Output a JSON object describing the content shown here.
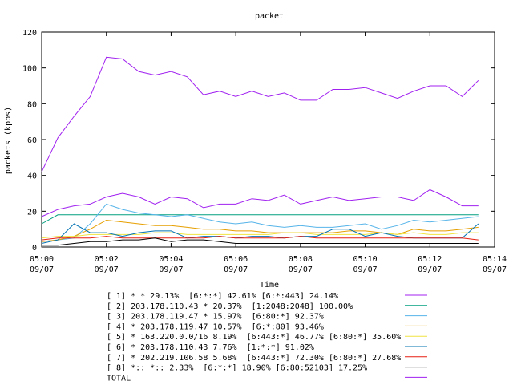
{
  "chart_data": {
    "type": "line",
    "title": "packet",
    "ylabel": "packets (kpps)",
    "xlabel": "Time",
    "ylim": [
      0,
      120
    ],
    "yticks": [
      0,
      20,
      40,
      60,
      80,
      100,
      120
    ],
    "xlim": [
      0,
      14
    ],
    "xticks": [
      {
        "t": 0,
        "time": "05:00",
        "date": "09/07"
      },
      {
        "t": 2,
        "time": "05:02",
        "date": "09/07"
      },
      {
        "t": 4,
        "time": "05:04",
        "date": "09/07"
      },
      {
        "t": 6,
        "time": "05:06",
        "date": "09/07"
      },
      {
        "t": 8,
        "time": "05:08",
        "date": "09/07"
      },
      {
        "t": 10,
        "time": "05:10",
        "date": "09/07"
      },
      {
        "t": 12,
        "time": "05:12",
        "date": "09/07"
      },
      {
        "t": 14,
        "time": "05:14",
        "date": "09/07"
      }
    ],
    "grid": false,
    "legend_position": "bottom",
    "x": [
      0,
      0.5,
      1,
      1.5,
      2,
      2.5,
      3,
      3.5,
      4,
      4.5,
      5,
      5.5,
      6,
      6.5,
      7,
      7.5,
      8,
      8.5,
      9,
      9.5,
      10,
      10.5,
      11,
      11.5,
      12,
      12.5,
      13,
      13.5
    ],
    "series": [
      {
        "name": "[ 1] * * 29.13%  [6:*:*] 42.61% [6:*:443] 24.14%",
        "color": "#a020f0",
        "values": [
          17,
          21,
          23,
          24,
          28,
          30,
          28,
          24,
          28,
          27,
          22,
          24,
          24,
          27,
          26,
          29,
          24,
          26,
          28,
          26,
          27,
          28,
          28,
          26,
          32,
          28,
          23,
          23
        ]
      },
      {
        "name": "[ 2] 203.178.110.43 * 20.37%  [1:2048:2048] 100.00%",
        "color": "#009f7f",
        "values": [
          13,
          18,
          18,
          18,
          18,
          18,
          18,
          18,
          18,
          18,
          18,
          18,
          18,
          18,
          18,
          18,
          18,
          18,
          18,
          18,
          18,
          18,
          18,
          18,
          18,
          18,
          18,
          18
        ]
      },
      {
        "name": "[ 3] 203.178.119.47 * 15.97%  [6:80:*] 92.37%",
        "color": "#56b4e9",
        "values": [
          3,
          4,
          5,
          13,
          24,
          21,
          19,
          18,
          17,
          18,
          16,
          14,
          13,
          14,
          12,
          11,
          12,
          11,
          11,
          12,
          13,
          10,
          12,
          15,
          14,
          15,
          16,
          17
        ]
      },
      {
        "name": "[ 4] * 203.178.119.47 10.57%  [6:*:80] 93.46%",
        "color": "#e69f00",
        "values": [
          3,
          4,
          6,
          10,
          15,
          14,
          13,
          12,
          12,
          11,
          10,
          10,
          9,
          9,
          8,
          8,
          8,
          8,
          8,
          9,
          9,
          8,
          7,
          10,
          9,
          9,
          10,
          11
        ]
      },
      {
        "name": "[ 5] * 163.220.0.0/16 8.19%  [6:443:*] 46.77% [6:80:*] 35.60%",
        "color": "#f0e442",
        "values": [
          5,
          6,
          6,
          7,
          7,
          7,
          7,
          8,
          8,
          7,
          7,
          7,
          7,
          7,
          7,
          8,
          8,
          7,
          7,
          7,
          7,
          8,
          7,
          8,
          7,
          7,
          8,
          8
        ]
      },
      {
        "name": "[ 6] * 203.178.110.43 7.76%  [1:*:*] 91.02%",
        "color": "#0072b2",
        "values": [
          2,
          4,
          13,
          8,
          8,
          6,
          8,
          9,
          9,
          5,
          6,
          6,
          5,
          6,
          6,
          5,
          6,
          6,
          10,
          10,
          6,
          8,
          6,
          5,
          5,
          5,
          5,
          13
        ]
      },
      {
        "name": "[ 7] * 202.219.106.58 5.68%  [6:443:*] 72.30% [6:80:*] 27.68%",
        "color": "#e51e10",
        "values": [
          4,
          5,
          5,
          5,
          6,
          5,
          5,
          5,
          5,
          5,
          5,
          6,
          5,
          5,
          5,
          5,
          6,
          5,
          5,
          5,
          5,
          5,
          5,
          5,
          5,
          5,
          5,
          4
        ]
      },
      {
        "name": "[ 8] *:: *:: 2.33%  [6:*:*] 18.90% [6:80:52103] 17.25%",
        "color": "#000000",
        "values": [
          1,
          1,
          2,
          3,
          3,
          4,
          4,
          5,
          3,
          4,
          4,
          3,
          2,
          2,
          2,
          2,
          2,
          2,
          2,
          2,
          2,
          2,
          2,
          2,
          2,
          2,
          2,
          2
        ]
      },
      {
        "name": "TOTAL",
        "color": "#a020f0",
        "values": [
          42,
          61,
          73,
          84,
          106,
          105,
          98,
          96,
          98,
          95,
          85,
          87,
          84,
          87,
          84,
          86,
          82,
          82,
          88,
          88,
          89,
          86,
          83,
          87,
          90,
          90,
          84,
          93
        ]
      }
    ]
  }
}
